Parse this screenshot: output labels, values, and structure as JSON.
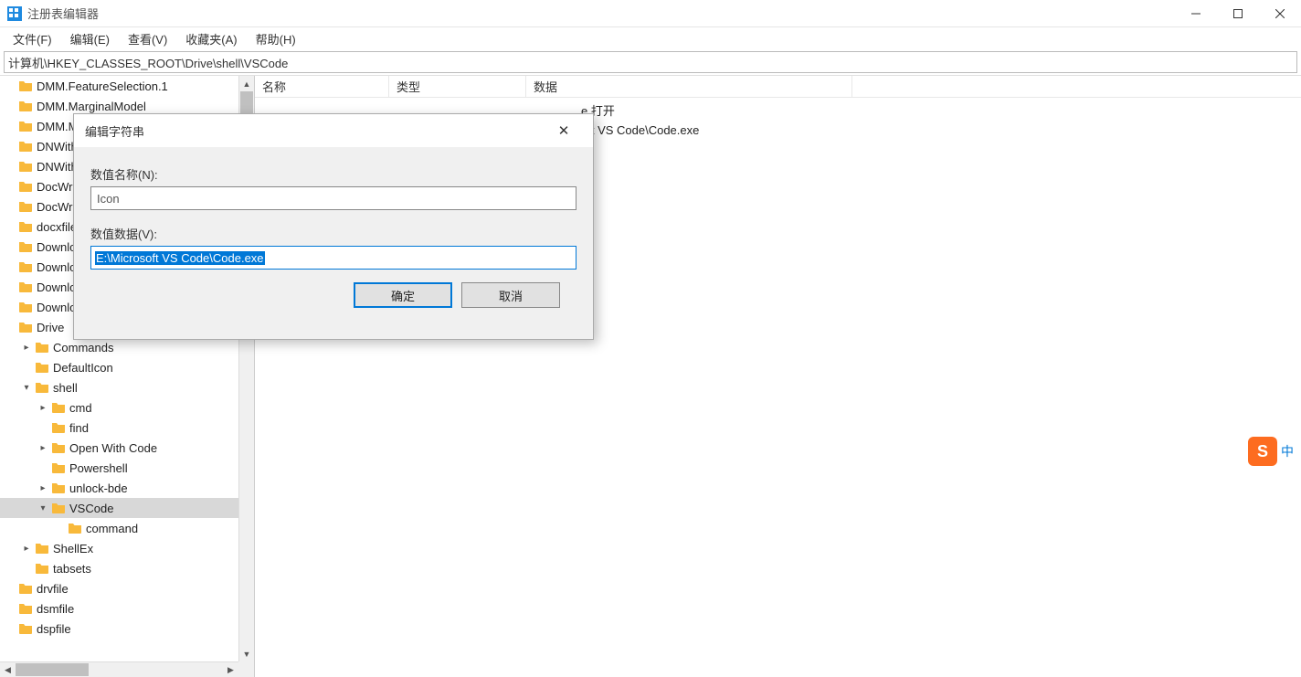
{
  "window": {
    "title": "注册表编辑器"
  },
  "menu": {
    "file": "文件(F)",
    "edit": "编辑(E)",
    "view": "查看(V)",
    "favorites": "收藏夹(A)",
    "help": "帮助(H)"
  },
  "address": "计算机\\HKEY_CLASSES_ROOT\\Drive\\shell\\VSCode",
  "tree": [
    {
      "indent": 0,
      "exp": "",
      "label": "DMM.FeatureSelection.1"
    },
    {
      "indent": 0,
      "exp": "",
      "label": "DMM.MarginalModel"
    },
    {
      "indent": 0,
      "exp": "",
      "label": "DMM.M"
    },
    {
      "indent": 0,
      "exp": "",
      "label": "DNWith"
    },
    {
      "indent": 0,
      "exp": "",
      "label": "DNWith"
    },
    {
      "indent": 0,
      "exp": "",
      "label": "DocWra"
    },
    {
      "indent": 0,
      "exp": "",
      "label": "DocWra"
    },
    {
      "indent": 0,
      "exp": "",
      "label": "docxfile"
    },
    {
      "indent": 0,
      "exp": "",
      "label": "Downlo"
    },
    {
      "indent": 0,
      "exp": "",
      "label": "Downlo"
    },
    {
      "indent": 0,
      "exp": "",
      "label": "Downlo"
    },
    {
      "indent": 0,
      "exp": "",
      "label": "Downlo"
    },
    {
      "indent": 0,
      "exp": "",
      "label": "Drive"
    },
    {
      "indent": 1,
      "exp": ">",
      "label": "Commands"
    },
    {
      "indent": 1,
      "exp": "",
      "label": "DefaultIcon"
    },
    {
      "indent": 1,
      "exp": "v",
      "label": "shell"
    },
    {
      "indent": 2,
      "exp": ">",
      "label": "cmd"
    },
    {
      "indent": 2,
      "exp": "",
      "label": "find"
    },
    {
      "indent": 2,
      "exp": ">",
      "label": "Open With Code"
    },
    {
      "indent": 2,
      "exp": "",
      "label": "Powershell"
    },
    {
      "indent": 2,
      "exp": ">",
      "label": "unlock-bde"
    },
    {
      "indent": 2,
      "exp": "v",
      "label": "VSCode",
      "selected": true
    },
    {
      "indent": 3,
      "exp": "",
      "label": "command"
    },
    {
      "indent": 1,
      "exp": ">",
      "label": "ShellEx"
    },
    {
      "indent": 1,
      "exp": "",
      "label": "tabsets"
    },
    {
      "indent": 0,
      "exp": "",
      "label": "drvfile"
    },
    {
      "indent": 0,
      "exp": "",
      "label": "dsmfile"
    },
    {
      "indent": 0,
      "exp": "",
      "label": "dspfile"
    }
  ],
  "list": {
    "cols": {
      "name": "名称",
      "type": "类型",
      "data": "数据"
    },
    "rows": [
      {
        "fragment_data": "e 打开"
      },
      {
        "fragment_data": "oft VS Code\\Code.exe"
      }
    ]
  },
  "dialog": {
    "title": "编辑字符串",
    "name_label": "数值名称(N):",
    "name_value": "Icon",
    "data_label": "数值数据(V):",
    "data_value": "E:\\Microsoft VS Code\\Code.exe",
    "ok": "确定",
    "cancel": "取消"
  },
  "ime": {
    "glyph": "S",
    "label": "中"
  }
}
